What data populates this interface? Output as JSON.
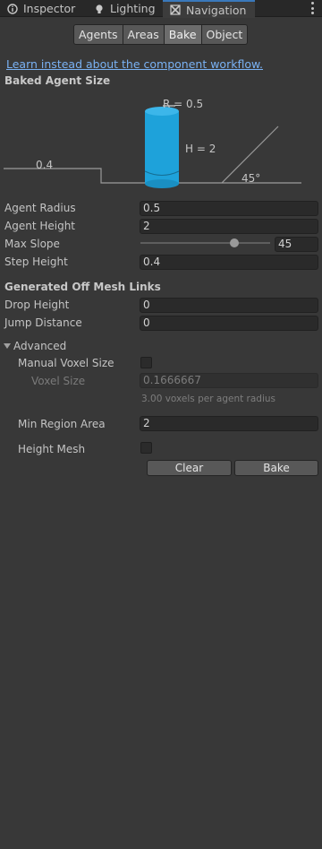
{
  "tabs": [
    {
      "label": "Inspector",
      "icon": "inspector-icon"
    },
    {
      "label": "Lighting",
      "icon": "lightbulb-icon"
    },
    {
      "label": "Navigation",
      "icon": "navigation-icon",
      "active": true
    }
  ],
  "toolbar": {
    "buttons": [
      "Agents",
      "Areas",
      "Bake",
      "Object"
    ],
    "selected": "Bake"
  },
  "link_text": "Learn instead about the component workflow.",
  "baked_agent_size": {
    "header": "Baked Agent Size",
    "diagram": {
      "radius_label": "R = 0.5",
      "height_label": "H = 2",
      "step_label": "0.4",
      "slope_label": "45°"
    },
    "agent_radius": {
      "label": "Agent Radius",
      "value": "0.5"
    },
    "agent_height": {
      "label": "Agent Height",
      "value": "2"
    },
    "max_slope": {
      "label": "Max Slope",
      "value": "45",
      "slider_fraction": 0.7
    },
    "step_height": {
      "label": "Step Height",
      "value": "0.4"
    }
  },
  "off_mesh": {
    "header": "Generated Off Mesh Links",
    "drop_height": {
      "label": "Drop Height",
      "value": "0"
    },
    "jump_distance": {
      "label": "Jump Distance",
      "value": "0"
    }
  },
  "advanced": {
    "label": "Advanced",
    "manual_voxel_size": {
      "label": "Manual Voxel Size",
      "checked": false
    },
    "voxel_size": {
      "label": "Voxel Size",
      "value": "0.1666667",
      "note": "3.00 voxels per agent radius"
    },
    "min_region_area": {
      "label": "Min Region Area",
      "value": "2"
    },
    "height_mesh": {
      "label": "Height Mesh",
      "checked": false
    }
  },
  "actions": {
    "clear": "Clear",
    "bake": "Bake"
  },
  "colors": {
    "accent": "#3a79bb",
    "link": "#7ab2f4",
    "cylinder": "#1ea2da"
  }
}
